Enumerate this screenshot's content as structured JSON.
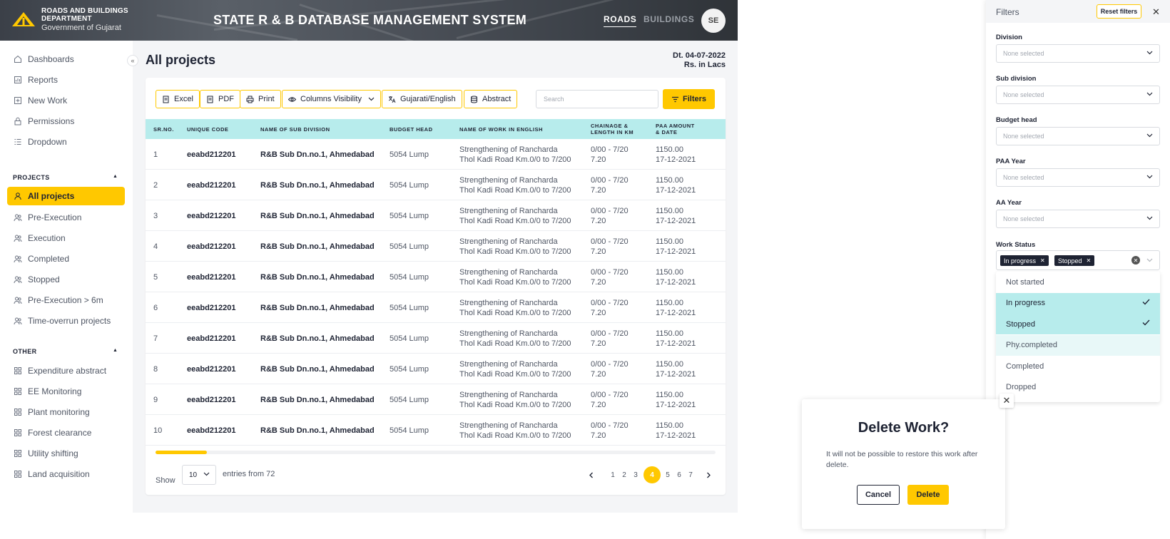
{
  "header": {
    "brand_line1": "ROADS AND BUILDINGS",
    "brand_line2": "DEPARTMENT",
    "brand_line3": "Government of Gujarat",
    "app_title": "STATE R & B DATABASE MANAGEMENT SYSTEM",
    "nav_roads": "ROADS",
    "nav_buildings": "BUILDINGS",
    "avatar_initials": "SE"
  },
  "sidebar": {
    "items": [
      {
        "label": "Dashboards",
        "icon": "home-icon"
      },
      {
        "label": "Reports",
        "icon": "report-icon"
      },
      {
        "label": "New Work",
        "icon": "plus-square-icon"
      },
      {
        "label": "Permissions",
        "icon": "lock-icon"
      },
      {
        "label": "Dropdown",
        "icon": "list-icon"
      }
    ],
    "projects_heading": "PROJECTS",
    "projects": [
      {
        "label": "All projects",
        "icon": "user-icon",
        "active": true
      },
      {
        "label": "Pre-Execution",
        "icon": "users-icon"
      },
      {
        "label": "Execution",
        "icon": "users-icon"
      },
      {
        "label": "Completed",
        "icon": "users-icon"
      },
      {
        "label": "Stopped",
        "icon": "users-icon"
      },
      {
        "label": "Pre-Execution > 6m",
        "icon": "users-icon"
      },
      {
        "label": "Time-overrun projects",
        "icon": "users-icon"
      }
    ],
    "other_heading": "OTHER",
    "other": [
      {
        "label": "Expenditure abstract",
        "icon": "grid-icon"
      },
      {
        "label": "EE Monitoring",
        "icon": "grid-icon"
      },
      {
        "label": "Plant monitoring",
        "icon": "grid-icon"
      },
      {
        "label": "Forest clearance",
        "icon": "grid-icon"
      },
      {
        "label": "Utility shifting",
        "icon": "grid-icon"
      },
      {
        "label": "Land acquisition",
        "icon": "grid-icon"
      }
    ]
  },
  "page": {
    "title": "All projects",
    "date": "Dt. 04-07-2022",
    "unit": "Rs. in Lacs"
  },
  "toolbar": {
    "excel": "Excel",
    "pdf": "PDF",
    "print": "Print",
    "columns": "Columns Visibility",
    "lang": "Gujarati/English",
    "abstract": "Abstract",
    "search_placeholder": "Search",
    "filters": "Filters"
  },
  "table": {
    "headers": {
      "sr": "SR.NO.",
      "code": "UNIQUE CODE",
      "subdiv": "NAME OF SUB DIVISION",
      "budget": "BUDGET HEAD",
      "work_name": "NAME OF WORK IN ENGLISH",
      "chainage_1": "CHAINAGE &",
      "chainage_2": "LENGTH IN KM",
      "paa_1": "PAA AMOUNT",
      "paa_2": "& DATE"
    },
    "rows": [
      {
        "sr": "1",
        "code": "eeabd212201",
        "subdiv": "R&B Sub Dn.no.1, Ahmedabad",
        "budget": "5054 Lump",
        "work1": "Strengthening of Rancharda",
        "work2": "Thol Kadi Road Km.0/0 to 7/200",
        "ch1": "0/00 - 7/20",
        "ch2": "7.20",
        "paa1": "1150.00",
        "paa2": "17-12-2021"
      },
      {
        "sr": "2",
        "code": "eeabd212201",
        "subdiv": "R&B Sub Dn.no.1, Ahmedabad",
        "budget": "5054 Lump",
        "work1": "Strengthening of Rancharda",
        "work2": "Thol Kadi Road Km.0/0 to 7/200",
        "ch1": "0/00 - 7/20",
        "ch2": "7.20",
        "paa1": "1150.00",
        "paa2": "17-12-2021"
      },
      {
        "sr": "3",
        "code": "eeabd212201",
        "subdiv": "R&B Sub Dn.no.1, Ahmedabad",
        "budget": "5054 Lump",
        "work1": "Strengthening of Rancharda",
        "work2": "Thol Kadi Road Km.0/0 to 7/200",
        "ch1": "0/00 - 7/20",
        "ch2": "7.20",
        "paa1": "1150.00",
        "paa2": "17-12-2021"
      },
      {
        "sr": "4",
        "code": "eeabd212201",
        "subdiv": "R&B Sub Dn.no.1, Ahmedabad",
        "budget": "5054 Lump",
        "work1": "Strengthening of Rancharda",
        "work2": "Thol Kadi Road Km.0/0 to 7/200",
        "ch1": "0/00 - 7/20",
        "ch2": "7.20",
        "paa1": "1150.00",
        "paa2": "17-12-2021"
      },
      {
        "sr": "5",
        "code": "eeabd212201",
        "subdiv": "R&B Sub Dn.no.1, Ahmedabad",
        "budget": "5054 Lump",
        "work1": "Strengthening of Rancharda",
        "work2": "Thol Kadi Road Km.0/0 to 7/200",
        "ch1": "0/00 - 7/20",
        "ch2": "7.20",
        "paa1": "1150.00",
        "paa2": "17-12-2021"
      },
      {
        "sr": "6",
        "code": "eeabd212201",
        "subdiv": "R&B Sub Dn.no.1, Ahmedabad",
        "budget": "5054 Lump",
        "work1": "Strengthening of Rancharda",
        "work2": "Thol Kadi Road Km.0/0 to 7/200",
        "ch1": "0/00 - 7/20",
        "ch2": "7.20",
        "paa1": "1150.00",
        "paa2": "17-12-2021"
      },
      {
        "sr": "7",
        "code": "eeabd212201",
        "subdiv": "R&B Sub Dn.no.1, Ahmedabad",
        "budget": "5054 Lump",
        "work1": "Strengthening of Rancharda",
        "work2": "Thol Kadi Road Km.0/0 to 7/200",
        "ch1": "0/00 - 7/20",
        "ch2": "7.20",
        "paa1": "1150.00",
        "paa2": "17-12-2021"
      },
      {
        "sr": "8",
        "code": "eeabd212201",
        "subdiv": "R&B Sub Dn.no.1, Ahmedabad",
        "budget": "5054 Lump",
        "work1": "Strengthening of Rancharda",
        "work2": "Thol Kadi Road Km.0/0 to 7/200",
        "ch1": "0/00 - 7/20",
        "ch2": "7.20",
        "paa1": "1150.00",
        "paa2": "17-12-2021"
      },
      {
        "sr": "9",
        "code": "eeabd212201",
        "subdiv": "R&B Sub Dn.no.1, Ahmedabad",
        "budget": "5054 Lump",
        "work1": "Strengthening of Rancharda",
        "work2": "Thol Kadi Road Km.0/0 to 7/200",
        "ch1": "0/00 - 7/20",
        "ch2": "7.20",
        "paa1": "1150.00",
        "paa2": "17-12-2021"
      },
      {
        "sr": "10",
        "code": "eeabd212201",
        "subdiv": "R&B Sub Dn.no.1, Ahmedabad",
        "budget": "5054 Lump",
        "work1": "Strengthening of Rancharda",
        "work2": "Thol Kadi Road Km.0/0 to 7/200",
        "ch1": "0/00 - 7/20",
        "ch2": "7.20",
        "paa1": "1150.00",
        "paa2": "17-12-2021"
      }
    ]
  },
  "footer": {
    "show_label": "Show",
    "page_size": "10",
    "entries_label": "entries from 72",
    "pages": [
      "1",
      "2",
      "3",
      "4",
      "5",
      "6",
      "7"
    ],
    "current_page": "4"
  },
  "filters_panel": {
    "title": "Filters",
    "reset": "Reset filters",
    "placeholder": "None selected",
    "fields": [
      "Division",
      "Sub division",
      "Budget head",
      "PAA Year",
      "AA Year"
    ],
    "work_status_label": "Work Status",
    "selected_tags": [
      "In progress",
      "Stopped"
    ],
    "options": [
      {
        "label": "Not started",
        "state": "none"
      },
      {
        "label": "In progress",
        "state": "selected"
      },
      {
        "label": "Stopped",
        "state": "selected"
      },
      {
        "label": "Phy.completed",
        "state": "hover"
      },
      {
        "label": "Completed",
        "state": "none"
      },
      {
        "label": "Dropped",
        "state": "none"
      }
    ]
  },
  "modal": {
    "title": "Delete Work?",
    "text": "It will not be possible to restore this work after delete.",
    "cancel": "Cancel",
    "delete": "Delete"
  },
  "colors": {
    "accent": "#ffc800",
    "table_header": "#b7ecec",
    "dark": "#1e2333"
  }
}
